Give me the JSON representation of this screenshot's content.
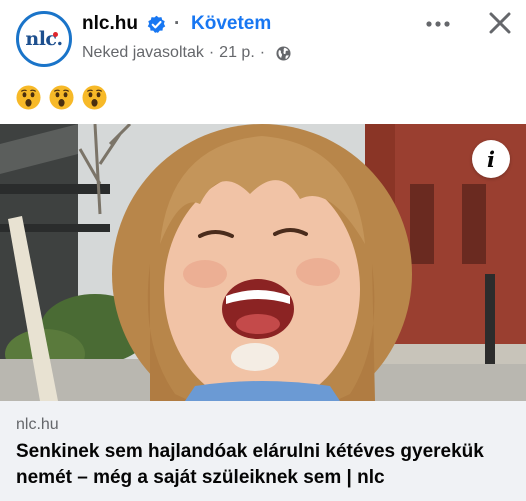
{
  "post": {
    "page_name": "nlc.hu",
    "avatar_text": "nlc.",
    "separator": "·",
    "follow_label": "Követem",
    "subtitle": "Neked javasoltak",
    "subtitle_sep": "·",
    "time": "21 p.",
    "time_sep": "·",
    "reactions": [
      "astonished-face",
      "astonished-face",
      "astonished-face"
    ],
    "info_label": "i"
  },
  "link_preview": {
    "domain": "nlc.hu",
    "title": "Senkinek sem hajlandóak elárulni kétéves gyerekük nemét – még a saját szüleiknek sem | nlc"
  },
  "colors": {
    "accent": "#1877f2",
    "secondary_text": "#65676b",
    "card_bg": "#f0f2f5"
  }
}
